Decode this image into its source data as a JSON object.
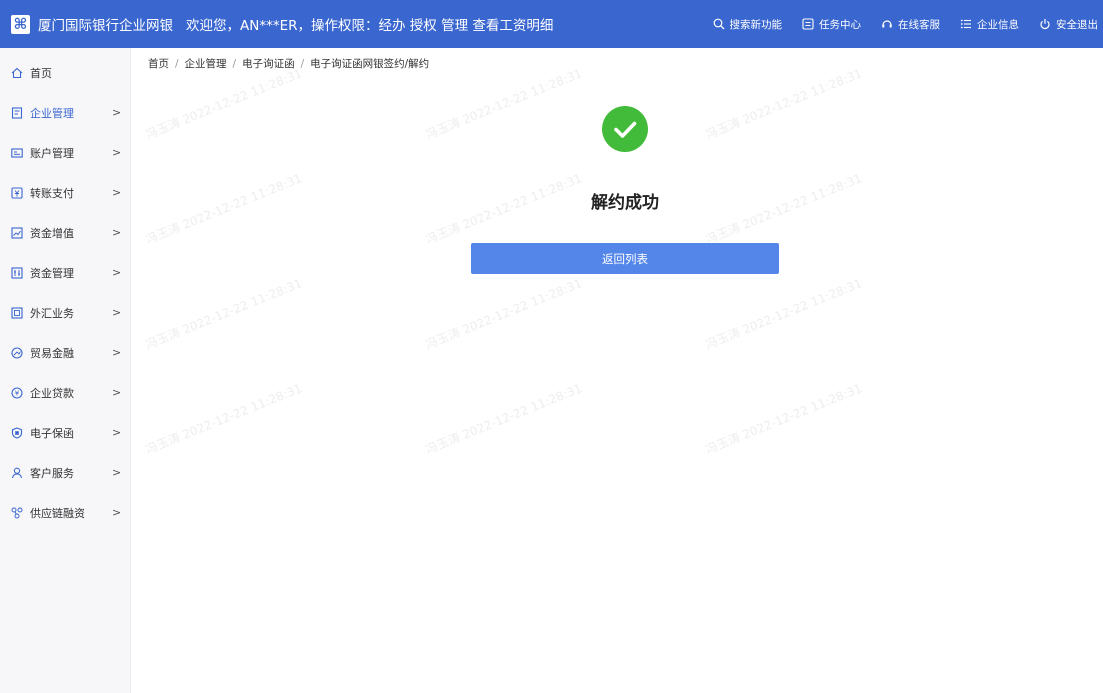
{
  "header": {
    "logo_glyph": "⌘",
    "bank_name": "厦门国际银行企业网银",
    "welcome": "欢迎您，AN***ER，操作权限：经办 授权 管理 查看工资明细",
    "actions": [
      {
        "label": "搜索新功能",
        "icon": "search-icon"
      },
      {
        "label": "任务中心",
        "icon": "task-icon"
      },
      {
        "label": "在线客服",
        "icon": "headset-icon"
      },
      {
        "label": "企业信息",
        "icon": "list-icon"
      },
      {
        "label": "安全退出",
        "icon": "power-icon"
      }
    ]
  },
  "sidebar": {
    "items": [
      {
        "label": "首页",
        "icon": "home-icon",
        "has_arrow": false
      },
      {
        "label": "企业管理",
        "icon": "enterprise-icon",
        "has_arrow": true,
        "active": true
      },
      {
        "label": "账户管理",
        "icon": "account-icon",
        "has_arrow": true
      },
      {
        "label": "转账支付",
        "icon": "transfer-icon",
        "has_arrow": true
      },
      {
        "label": "资金增值",
        "icon": "chart-icon",
        "has_arrow": true
      },
      {
        "label": "资金管理",
        "icon": "fund-icon",
        "has_arrow": true
      },
      {
        "label": "外汇业务",
        "icon": "forex-icon",
        "has_arrow": true
      },
      {
        "label": "贸易金融",
        "icon": "trade-icon",
        "has_arrow": true
      },
      {
        "label": "企业贷款",
        "icon": "loan-icon",
        "has_arrow": true
      },
      {
        "label": "电子保函",
        "icon": "guarantee-icon",
        "has_arrow": true
      },
      {
        "label": "客户服务",
        "icon": "user-icon",
        "has_arrow": true
      },
      {
        "label": "供应链融资",
        "icon": "supply-chain-icon",
        "has_arrow": true
      }
    ],
    "arrow_glyph": ">"
  },
  "breadcrumb": {
    "items": [
      "首页",
      "企业管理",
      "电子询证函",
      "电子询证函网银签约/解约"
    ],
    "separator": "/"
  },
  "result": {
    "icon": "success-check-icon",
    "title": "解约成功",
    "button_label": "返回列表"
  },
  "watermark": {
    "name": "冯玉涛",
    "timestamp": "2022-12-22 11:28:31"
  },
  "colors": {
    "brand": "#3a66cf",
    "success": "#42bb3a",
    "button": "#5486ea"
  }
}
